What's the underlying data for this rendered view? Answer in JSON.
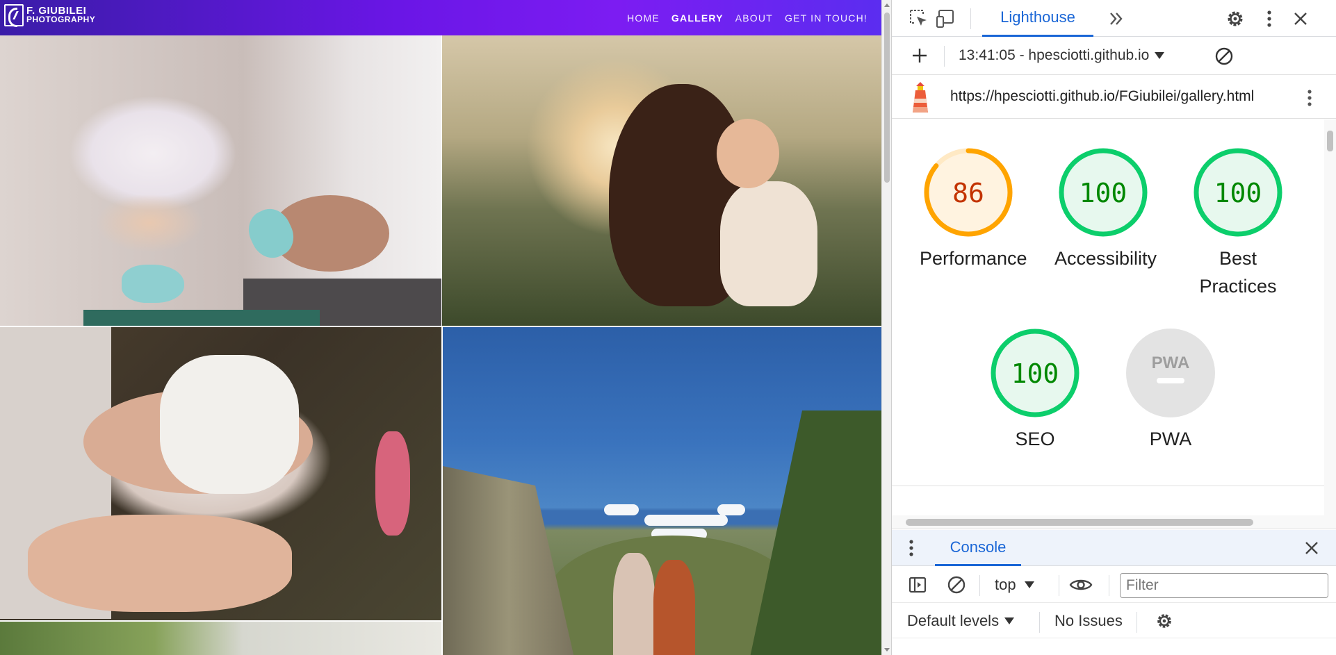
{
  "site": {
    "logo": {
      "line1": "F. GIUBILEI",
      "line2": "PHOTOGRAPHY"
    },
    "nav": [
      {
        "label": "HOME",
        "active": false
      },
      {
        "label": "GALLERY",
        "active": true
      },
      {
        "label": "ABOUT",
        "active": false
      },
      {
        "label": "GET IN TOUCH!",
        "active": false
      }
    ],
    "gradient_colors": [
      "#3a1ca8",
      "#7c1cf2"
    ]
  },
  "devtools": {
    "active_tab": "Lighthouse",
    "lighthouse": {
      "run_label": "13:41:05 - hpesciotti.github.io",
      "url": "https://hpesciotti.github.io/FGiubilei/gallery.html",
      "scores": [
        {
          "id": "performance",
          "label": "Performance",
          "score": "86",
          "value": 86,
          "status": "average"
        },
        {
          "id": "accessibility",
          "label": "Accessibility",
          "score": "100",
          "value": 100,
          "status": "pass"
        },
        {
          "id": "best-practices",
          "label": "Best Practices",
          "score": "100",
          "value": 100,
          "status": "pass"
        },
        {
          "id": "seo",
          "label": "SEO",
          "score": "100",
          "value": 100,
          "status": "pass"
        },
        {
          "id": "pwa",
          "label": "PWA",
          "badge": "PWA",
          "status": "na"
        }
      ],
      "colors": {
        "pass": "#0cce6b",
        "average": "#ffa400",
        "pass_text": "#008800",
        "average_text": "#c33300"
      }
    },
    "console": {
      "tab_label": "Console",
      "context": "top",
      "filter_placeholder": "Filter",
      "levels": "Default levels",
      "issues": "No Issues"
    }
  }
}
